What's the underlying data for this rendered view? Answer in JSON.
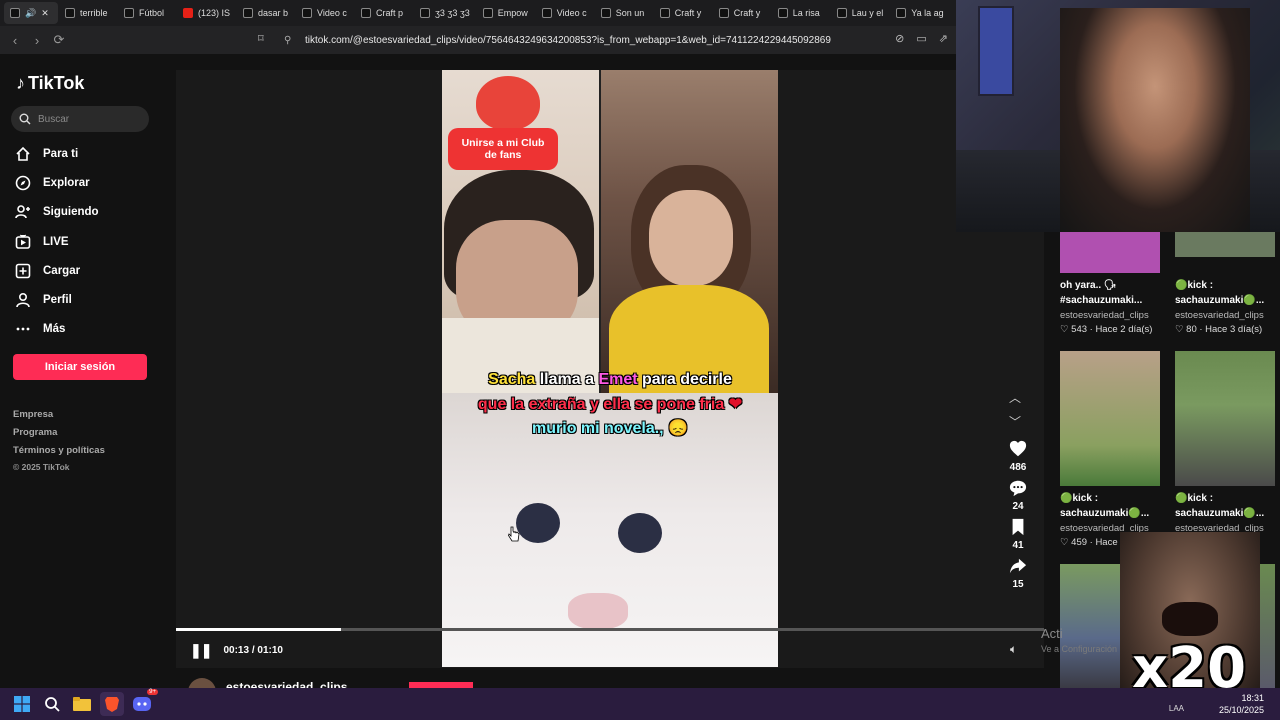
{
  "browser": {
    "tabs": [
      {
        "label": "",
        "icon": "tiktok-icon"
      },
      {
        "label": "terrible",
        "icon": "tiktok-icon"
      },
      {
        "label": "Fútbol",
        "icon": "tiktok-icon"
      },
      {
        "label": "(123) IS",
        "icon": "youtube-icon"
      },
      {
        "label": "dasar b",
        "icon": "tiktok-icon"
      },
      {
        "label": "Video c",
        "icon": "tiktok-icon"
      },
      {
        "label": "Craft p",
        "icon": "tiktok-icon"
      },
      {
        "label": "ʒ3 ʒ3 ʒ3",
        "icon": "tiktok-icon"
      },
      {
        "label": "Empow",
        "icon": "tiktok-icon"
      },
      {
        "label": "Video c",
        "icon": "tiktok-icon"
      },
      {
        "label": "Son un",
        "icon": "tiktok-icon"
      },
      {
        "label": "Craft y",
        "icon": "tiktok-icon"
      },
      {
        "label": "Craft y",
        "icon": "tiktok-icon"
      },
      {
        "label": "La risa",
        "icon": "tiktok-icon"
      },
      {
        "label": "Lau y el",
        "icon": "tiktok-icon"
      },
      {
        "label": "Ya la ag",
        "icon": "tiktok-icon"
      }
    ],
    "url": "tiktok.com/@estoesvariedad_clips/video/7564643249634200853?is_from_webapp=1&web_id=7411224229445092869"
  },
  "sidebar": {
    "logo": "TikTok",
    "search_placeholder": "Buscar",
    "nav": [
      {
        "label": "Para ti",
        "icon": "home-icon"
      },
      {
        "label": "Explorar",
        "icon": "compass-icon"
      },
      {
        "label": "Siguiendo",
        "icon": "following-icon"
      },
      {
        "label": "LIVE",
        "icon": "live-icon"
      },
      {
        "label": "Cargar",
        "icon": "upload-icon"
      },
      {
        "label": "Perfil",
        "icon": "profile-icon"
      },
      {
        "label": "Más",
        "icon": "more-icon"
      }
    ],
    "login_label": "Iniciar sesión",
    "footer": [
      "Empresa",
      "Programa",
      "Términos y políticas"
    ],
    "copyright": "© 2025 TikTok"
  },
  "video": {
    "fan_badge": "Unirse a mi Club de fans",
    "caption": {
      "line1": {
        "a": "Sacha",
        "b": " llama a ",
        "c": "Emet",
        "d": " para decirle"
      },
      "line2": "que la extraña y ella se pone fria",
      "line2_emoji": "❤",
      "line3": "murio mi novela.,",
      "line3_emoji": "😞"
    },
    "likes": "486",
    "comments": "24",
    "saves": "41",
    "shares": "15",
    "time": "00:13 / 01:10",
    "progress": 0.19,
    "channel": "estoesvariedad_clips"
  },
  "related": [
    {
      "title1": "oh yara.. 🗣",
      "title2": "#sachauzumaki...",
      "author": "estoesvariedad_clips",
      "meta": "♡ 543 · Hace 2 día(s)"
    },
    {
      "title1": "🟢kick :",
      "title2": "sachauzumaki🟢...",
      "author": "estoesvariedad_clips",
      "meta": "♡ 80 · Hace 3 día(s)"
    },
    {
      "title1": "🟢kick :",
      "title2": "sachauzumaki🟢...",
      "author": "estoesvariedad_clips",
      "meta": "♡ 459 · Hace"
    },
    {
      "title1": "🟢kick :",
      "title2": "sachauzumaki🟢...",
      "author": "estoesvariedad_clips",
      "meta": ""
    }
  ],
  "overlay": {
    "meme_text": "x20",
    "activate_title": "Acti",
    "activate_sub": "Ve a Configuración"
  },
  "taskbar": {
    "time": "18:31",
    "date": "25/10/2025",
    "lang": "LAA",
    "badge": "9+"
  },
  "colors": {
    "brand": "#fe2c55",
    "bg": "#121212",
    "taskbar": "#2a1c3e"
  }
}
